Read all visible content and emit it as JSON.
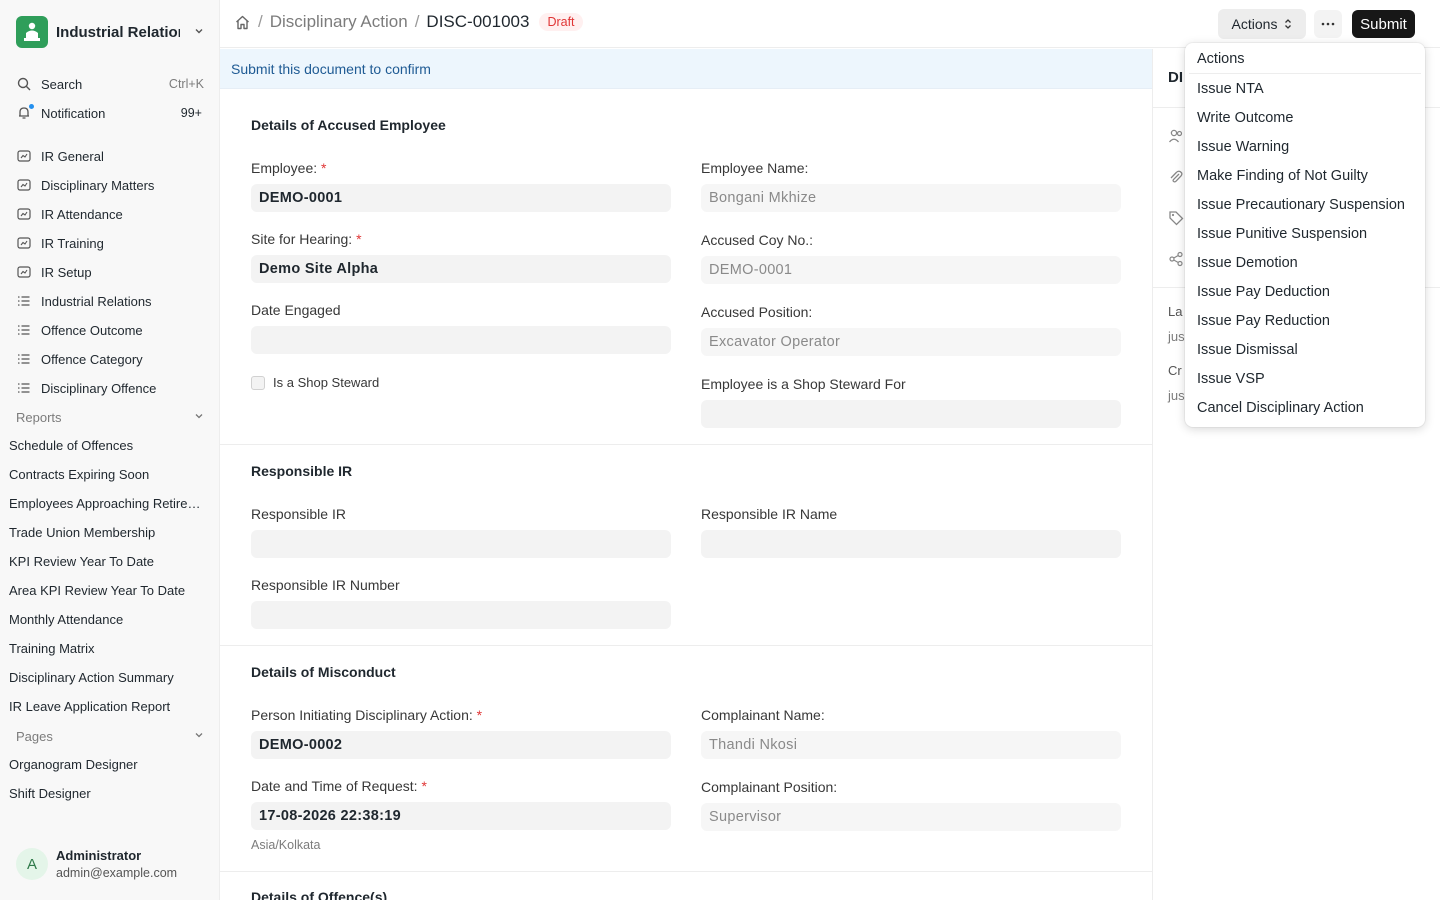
{
  "sidebar": {
    "app_name": "Industrial Relations",
    "search_label": "Search",
    "search_shortcut": "Ctrl+K",
    "notification_label": "Notification",
    "notification_count": "99+",
    "nav_items": [
      {
        "label": "IR General",
        "icon": "workspace-icon"
      },
      {
        "label": "Disciplinary Matters",
        "icon": "workspace-icon"
      },
      {
        "label": "IR Attendance",
        "icon": "workspace-icon"
      },
      {
        "label": "IR Training",
        "icon": "workspace-icon"
      },
      {
        "label": "IR Setup",
        "icon": "workspace-icon"
      },
      {
        "label": "Industrial Relations",
        "icon": "list-icon"
      },
      {
        "label": "Offence Outcome",
        "icon": "list-icon"
      },
      {
        "label": "Offence Category",
        "icon": "list-icon"
      },
      {
        "label": "Disciplinary Offence",
        "icon": "list-icon"
      }
    ],
    "reports_heading": "Reports",
    "reports": [
      "Schedule of Offences",
      "Contracts Expiring Soon",
      "Employees Approaching Retirement",
      "Trade Union Membership",
      "KPI Review Year To Date",
      "Area KPI Review Year To Date",
      "Monthly Attendance",
      "Training Matrix",
      "Disciplinary Action Summary",
      "IR Leave Application Report"
    ],
    "pages_heading": "Pages",
    "pages": [
      "Organogram Designer",
      "Shift Designer"
    ],
    "user": {
      "initial": "A",
      "name": "Administrator",
      "email": "admin@example.com"
    }
  },
  "topbar": {
    "breadcrumb_parent": "Disciplinary Action",
    "breadcrumb_current": "DISC-001003",
    "status": "Draft",
    "actions_label": "Actions",
    "submit_label": "Submit"
  },
  "banner": "Submit this document to confirm",
  "sections": {
    "accused": {
      "title": "Details of Accused Employee",
      "employee_label": "Employee:",
      "employee_value": "DEMO-0001",
      "employee_name_label": "Employee Name:",
      "employee_name_value": "Bongani Mkhize",
      "site_label": "Site for Hearing:",
      "site_value": "Demo Site Alpha",
      "coy_label": "Accused Coy No.:",
      "coy_value": "DEMO-0001",
      "date_engaged_label": "Date Engaged",
      "date_engaged_value": "",
      "position_label": "Accused Position:",
      "position_value": "Excavator Operator",
      "shop_steward_label": "Is a Shop Steward",
      "shop_steward_for_label": "Employee is a Shop Steward For",
      "shop_steward_for_value": ""
    },
    "responsible": {
      "title": "Responsible IR",
      "ir_label": "Responsible IR",
      "ir_name_label": "Responsible IR Name",
      "ir_number_label": "Responsible IR Number"
    },
    "misconduct": {
      "title": "Details of Misconduct",
      "initiator_label": "Person Initiating Disciplinary Action:",
      "initiator_value": "DEMO-0002",
      "complainant_name_label": "Complainant Name:",
      "complainant_name_value": "Thandi Nkosi",
      "request_date_label": "Date and Time of Request:",
      "request_date_value": "17-08-2026 22:38:19",
      "timezone": "Asia/Kolkata",
      "complainant_position_label": "Complainant Position:",
      "complainant_position_value": "Supervisor"
    },
    "offences": {
      "title": "Details of Offence(s)"
    }
  },
  "right_sidebar": {
    "title_fragment": "DI",
    "last_fragment": "La",
    "last_value_fragment": "jus",
    "created_fragment": "Cr",
    "created_value_fragment": "jus"
  },
  "dropdown": {
    "heading": "Actions",
    "items": [
      "Issue NTA",
      "Write Outcome",
      "Issue Warning",
      "Make Finding of Not Guilty",
      "Issue Precautionary Suspension",
      "Issue Punitive Suspension",
      "Issue Demotion",
      "Issue Pay Deduction",
      "Issue Pay Reduction",
      "Issue Dismissal",
      "Issue VSP",
      "Cancel Disciplinary Action"
    ]
  },
  "colors": {
    "accent": "#171717",
    "draft": "#e03636",
    "banner": "#edf6fd",
    "logo": "#2f9e5a"
  }
}
